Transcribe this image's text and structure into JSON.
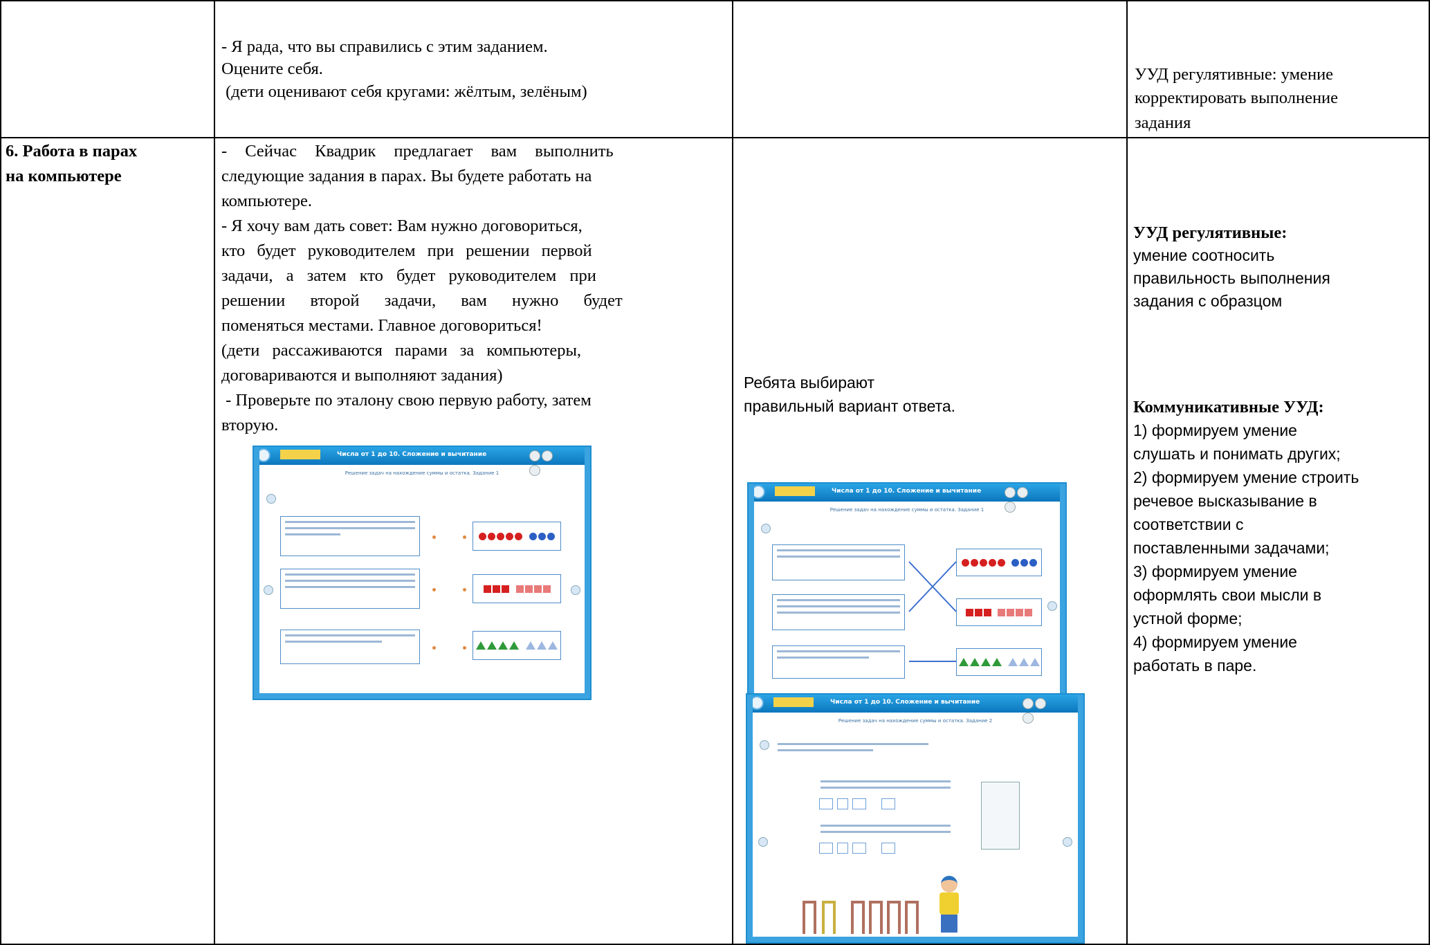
{
  "row1": {
    "teacher_lines": [
      "- Я рада, что вы справились с этим заданием.",
      "Оцените себя.",
      " (дети оценивают себя кругами: жёлтым, зелёным)"
    ],
    "uud_lines": [
      "УУД регулятивные: умение",
      "корректировать выполнение",
      "задания"
    ]
  },
  "row2": {
    "stage_lines": [
      "6. Работа в парах",
      "на компьютере"
    ],
    "teacher_lines": [
      "- Сейчас Квадрик предлагает вам выполнить",
      "следующие задания в парах. Вы будете работать на",
      "компьютере.",
      "- Я хочу вам дать совет: Вам нужно договориться,",
      "кто будет руководителем при решении первой",
      "задачи, а затем кто будет руководителем при",
      "решении второй задачи, вам нужно будет",
      "поменяться местами. Главное договориться!",
      "(дети рассаживаются парами за компьютеры,",
      "договариваются и выполняют задания)",
      " - Проверьте по эталону свою первую работу, затем",
      "вторую."
    ],
    "student_lines": [
      "Ребята выбирают",
      "правильный вариант ответа."
    ],
    "uud_reg_title": "УУД регулятивные:",
    "uud_reg_lines": [
      "умение соотносить",
      "правильность выполнения",
      "задания с образцом"
    ],
    "uud_comm_title": "Коммуникативные УУД:",
    "uud_comm_lines": [
      "1) формируем умение",
      "слушать и понимать других;",
      "2) формируем умение строить",
      "речевое высказывание в",
      "соответствии с",
      "поставленными задачами;",
      "3) формируем умение",
      "оформлять свои мысли в",
      "устной форме;",
      "4) формируем умение",
      "работать в паре."
    ]
  },
  "screens": {
    "title": "Числа от 1 до 10. Сложение и вычитание",
    "subtitle1": "Решение задач на нахождение суммы и остатка. Задание 1",
    "subtitle2": "Решение задач на нахождение суммы и остатка. Задание 2"
  },
  "colors": {
    "frame": "#1e8fd0",
    "red": "#d62020",
    "blue": "#2b5fc4",
    "green": "#2f9a3a"
  }
}
